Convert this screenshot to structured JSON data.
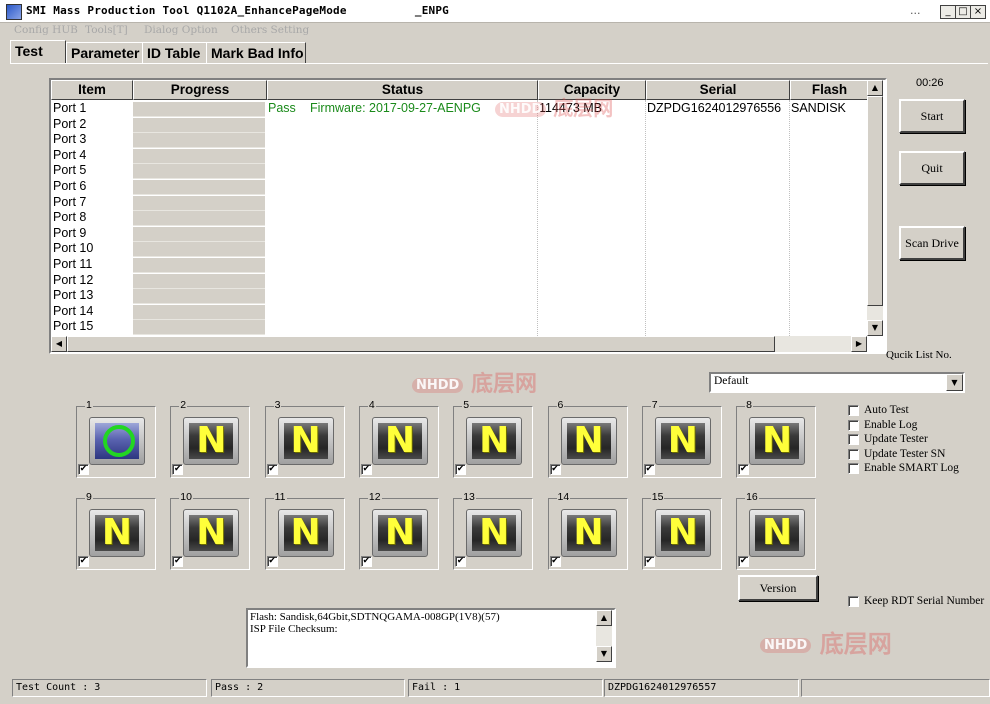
{
  "window": {
    "title": "SMI Mass Production Tool Q1102A_EnhancePageMode          _ENPG",
    "dots": "...",
    "minimize": "_",
    "maximize": "□",
    "close": "×"
  },
  "menu": [
    "Config HUB",
    "Tools[T]",
    "Dialog Option",
    "Others Setting"
  ],
  "tabs": [
    "Test",
    "Parameter",
    "ID Table",
    "Mark Bad Info"
  ],
  "table": {
    "columns": [
      "Item",
      "Progress",
      "Status",
      "Capacity",
      "Serial",
      "Flash"
    ],
    "rows": [
      {
        "item": "Port 1",
        "status_result": "Pass",
        "status_detail": "Firmware: 2017-09-27-AENPG",
        "capacity": "114473 MB",
        "serial": "DZPDG1624012976556",
        "flash": "SANDISK"
      },
      {
        "item": "Port 2"
      },
      {
        "item": "Port 3"
      },
      {
        "item": "Port 4"
      },
      {
        "item": "Port 5"
      },
      {
        "item": "Port 6"
      },
      {
        "item": "Port 7"
      },
      {
        "item": "Port 8"
      },
      {
        "item": "Port 9"
      },
      {
        "item": "Port 10"
      },
      {
        "item": "Port 11"
      },
      {
        "item": "Port 12"
      },
      {
        "item": "Port 13"
      },
      {
        "item": "Port 14"
      },
      {
        "item": "Port 15"
      }
    ],
    "status_color": "#1a8a1a"
  },
  "timer": "00:26",
  "buttons": {
    "start": "Start",
    "quit": "Quit",
    "scan": "Scan Drive",
    "version": "Version"
  },
  "quick_list": {
    "label": "Qucik List No.",
    "value": "Default"
  },
  "ports": [
    {
      "num": "1",
      "state": "pass",
      "checked": true
    },
    {
      "num": "2",
      "state": "N",
      "checked": true
    },
    {
      "num": "3",
      "state": "N",
      "checked": true
    },
    {
      "num": "4",
      "state": "N",
      "checked": true
    },
    {
      "num": "5",
      "state": "N",
      "checked": true
    },
    {
      "num": "6",
      "state": "N",
      "checked": true
    },
    {
      "num": "7",
      "state": "N",
      "checked": true
    },
    {
      "num": "8",
      "state": "N",
      "checked": true
    },
    {
      "num": "9",
      "state": "N",
      "checked": true
    },
    {
      "num": "10",
      "state": "N",
      "checked": true
    },
    {
      "num": "11",
      "state": "N",
      "checked": true
    },
    {
      "num": "12",
      "state": "N",
      "checked": true
    },
    {
      "num": "13",
      "state": "N",
      "checked": true
    },
    {
      "num": "14",
      "state": "N",
      "checked": true
    },
    {
      "num": "15",
      "state": "N",
      "checked": true
    },
    {
      "num": "16",
      "state": "N",
      "checked": true
    }
  ],
  "options": [
    "Auto Test",
    "Enable Log",
    "Update Tester",
    "Update Tester SN",
    "Enable SMART Log"
  ],
  "keep_rdt": "Keep RDT Serial Number",
  "memo": {
    "line1": "Flash: Sandisk,64Gbit,SDTNQGAMA-008GP(1V8)(57)",
    "line2": "ISP File Checksum:"
  },
  "status": {
    "test_count": "Test Count : 3",
    "pass": "Pass : 2",
    "fail": "Fail : 1",
    "serial": "DZPDG1624012976557"
  },
  "watermark": {
    "box": "NHDD",
    "text": "底层网"
  }
}
